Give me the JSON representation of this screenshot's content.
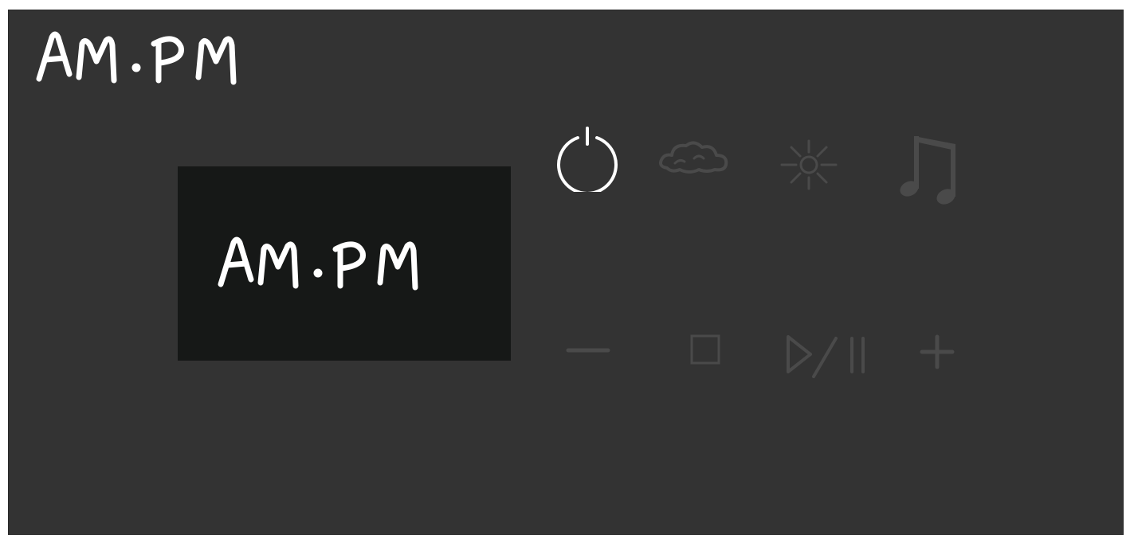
{
  "brand": {
    "logo_text": "AM·PM"
  },
  "display": {
    "text": "AM·PM"
  },
  "top_controls": [
    {
      "name": "power",
      "icon": "power-icon",
      "active": true
    },
    {
      "name": "weather",
      "icon": "cloud-icon",
      "active": false
    },
    {
      "name": "light",
      "icon": "sun-icon",
      "active": false
    },
    {
      "name": "music",
      "icon": "music-note-icon",
      "active": false
    }
  ],
  "bottom_controls": [
    {
      "name": "decrease",
      "icon": "minus-icon",
      "active": false
    },
    {
      "name": "stop",
      "icon": "stop-icon",
      "active": false
    },
    {
      "name": "play-pause",
      "icon": "play-pause-icon",
      "active": false
    },
    {
      "name": "increase",
      "icon": "plus-icon",
      "active": false
    }
  ],
  "colors": {
    "panel": "#333333",
    "screen": "#161817",
    "active_icon": "#ffffff",
    "inactive_icon": "#4a4a4a",
    "text": "#ffffff"
  }
}
